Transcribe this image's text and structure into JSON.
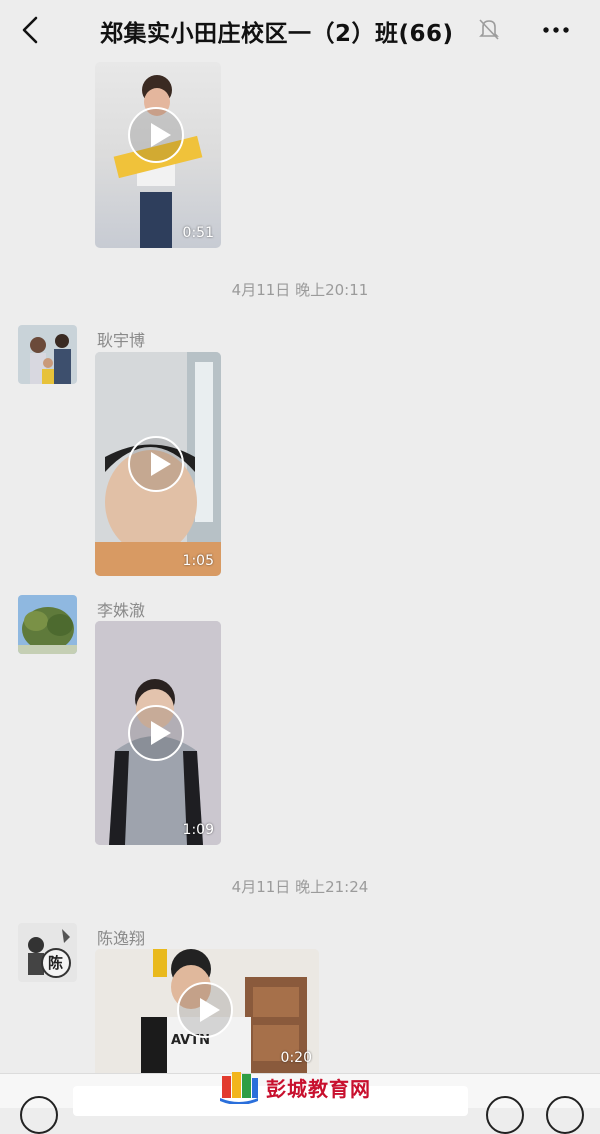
{
  "header": {
    "title": "郑集实小田庄校区一（2）班(66)",
    "back_icon": "chevron-left-icon",
    "mute_icon": "bell-off-icon",
    "more_icon": "more-dots-icon"
  },
  "messages": [
    {
      "type": "video",
      "sender": "",
      "duration": "0:51"
    },
    {
      "type": "timestamp",
      "text": "4月11日 晚上20:11"
    },
    {
      "type": "video",
      "sender": "耿宇博",
      "duration": "1:05"
    },
    {
      "type": "video",
      "sender": "李姝澈",
      "duration": "1:09"
    },
    {
      "type": "timestamp",
      "text": "4月11日 晚上21:24"
    },
    {
      "type": "video",
      "sender": "陈逸翔",
      "duration": "0:20",
      "avatar_text": "陈"
    }
  ],
  "watermark": {
    "text": "彭城教育网",
    "icon": "book-logo-icon"
  },
  "colors": {
    "background": "#ededed",
    "timestamp": "#9b9b9b",
    "sender": "#8a8a8a",
    "watermark": "#c8102e"
  }
}
